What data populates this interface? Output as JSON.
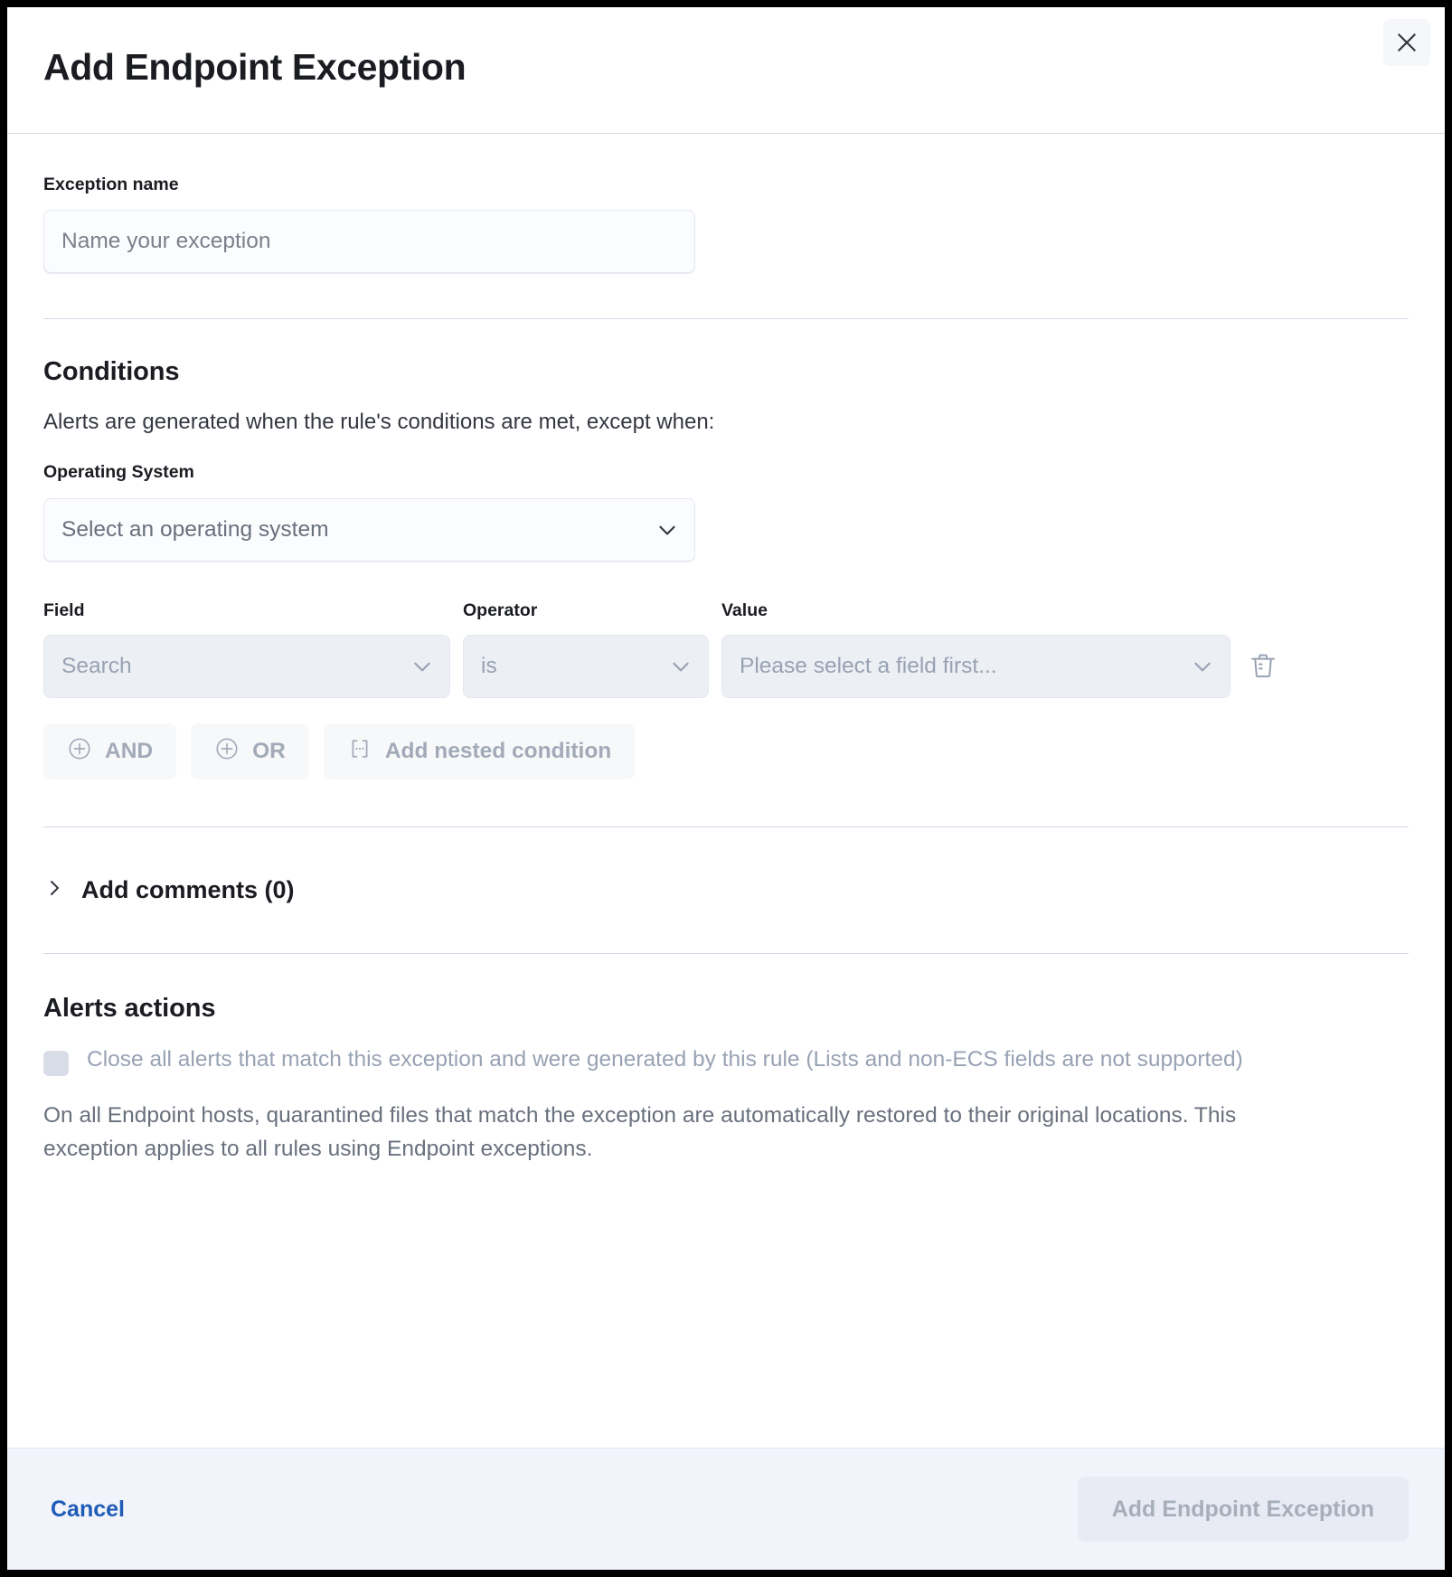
{
  "flyout": {
    "title": "Add Endpoint Exception",
    "close_icon": "close-icon"
  },
  "name_section": {
    "label": "Exception name",
    "input_placeholder": "Name your exception",
    "input_value": ""
  },
  "conditions": {
    "heading": "Conditions",
    "helper_text": "Alerts are generated when the rule's conditions are met, except when:",
    "os_label": "Operating System",
    "os_placeholder": "Select an operating system",
    "column_labels": {
      "field": "Field",
      "operator": "Operator",
      "value": "Value"
    },
    "entry": {
      "field_placeholder": "Search",
      "operator_value": "is",
      "value_placeholder": "Please select a field first...",
      "delete_icon": "trash-icon"
    },
    "logic_buttons": [
      {
        "label": "AND",
        "icon": "plus-circle-icon"
      },
      {
        "label": "OR",
        "icon": "plus-circle-icon"
      },
      {
        "label": "Add nested condition",
        "icon": "nested-brackets-icon"
      }
    ]
  },
  "comments": {
    "label": "Add comments (0)",
    "toggle_icon": "chevron-right-icon"
  },
  "alerts_actions": {
    "heading": "Alerts actions",
    "checkbox_label": "Close all alerts that match this exception and were generated by this rule (Lists and non-ECS fields are not supported)",
    "checkbox_checked": false,
    "description": "On all Endpoint hosts, quarantined files that match the exception are automatically restored to their original locations. This exception applies to all rules using Endpoint exceptions."
  },
  "footer": {
    "cancel_label": "Cancel",
    "submit_label": "Add Endpoint Exception",
    "submit_disabled": true
  },
  "colors": {
    "accent_link": "#1f5cb7",
    "text_primary": "#1a1c21",
    "text_muted": "#98a2b3",
    "divider": "#d3dae6",
    "footer_bg": "#f1f4fa"
  }
}
